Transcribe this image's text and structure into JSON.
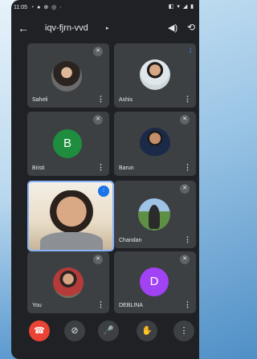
{
  "status_bar": {
    "time": "11:05",
    "left_icons": "◔ ● ⊕ ◎ ·",
    "right_icons": "◧ ▾ ◢ ▮"
  },
  "meeting": {
    "code": "iqv-fjrn-vvd",
    "caret": "▸"
  },
  "icons": {
    "back": "←",
    "volume": "◀)",
    "flip": "⟲",
    "more": "⋮",
    "mute": "✕",
    "speaking": "⦙"
  },
  "participants": [
    {
      "name": "Saheli"
    },
    {
      "name": "Ashis"
    },
    {
      "name": "Bristi",
      "initial": "B",
      "color": "#1e8e3e"
    },
    {
      "name": "Barun"
    },
    {
      "name": ""
    },
    {
      "name": "Chandan"
    },
    {
      "name": "You"
    },
    {
      "name": "DEBLINA",
      "initial": "D",
      "color": "#a142f4"
    }
  ],
  "controls": {
    "end_call": "☎",
    "camera_off": "⊘",
    "mic_off": "🎤",
    "raise_hand": "✋",
    "more": "⋮"
  }
}
